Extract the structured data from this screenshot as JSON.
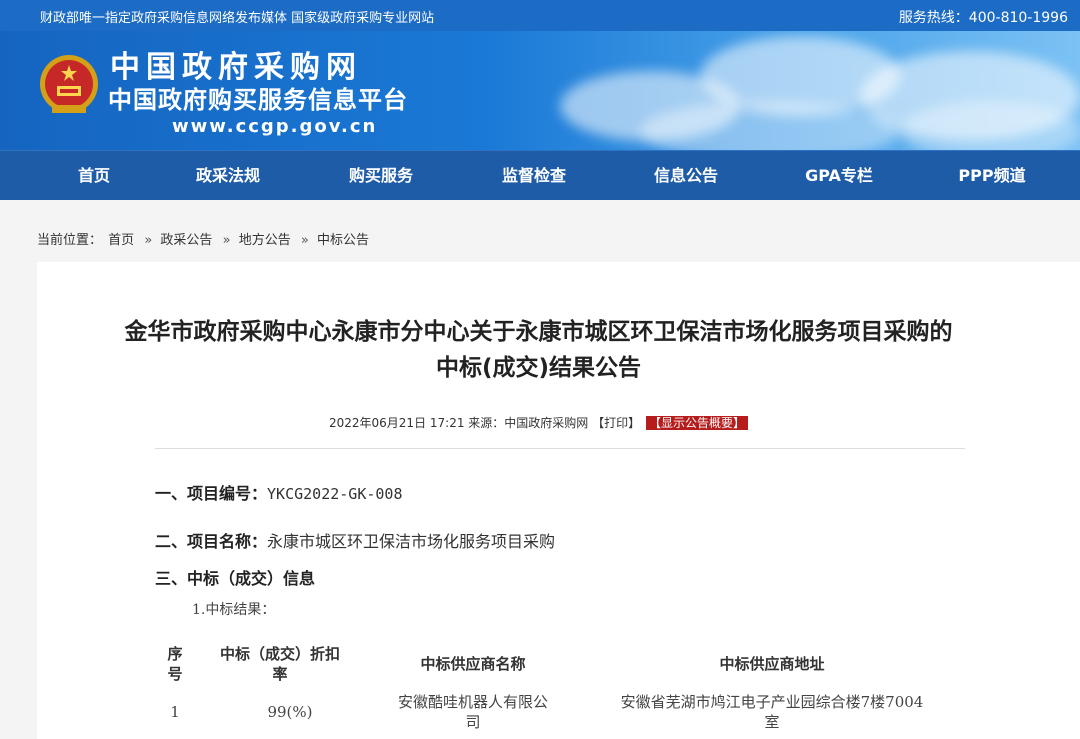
{
  "topbar": {
    "left_text": "财政部唯一指定政府采购信息网络发布媒体 国家级政府采购专业网站",
    "hotline": "服务热线：400-810-1996"
  },
  "logo": {
    "name": "中国政府采购网",
    "subtitle": "中国政府购买服务信息平台",
    "url": "www.ccgp.gov.cn"
  },
  "nav": {
    "items": [
      "首页",
      "政采法规",
      "购买服务",
      "监督检查",
      "信息公告",
      "GPA专栏",
      "PPP频道"
    ]
  },
  "breadcrumb": {
    "label": "当前位置：",
    "items": [
      "首页",
      "政采公告",
      "地方公告",
      "中标公告"
    ],
    "sep": "»"
  },
  "article": {
    "title_line1": "金华市政府采购中心永康市分中心关于永康市城区环卫保洁市场化服务项目采购的",
    "title_line2": "中标(成交)结果公告",
    "datetime": "2022年06月21日 17:21",
    "source": "来源：中国政府采购网",
    "print_label": "【打印】",
    "summary_label": "【显示公告概要】",
    "section1_label": "一、项目编号：",
    "section1_value": "YKCG2022-GK-008",
    "section2_label": "二、项目名称：",
    "section2_value": "永康市城区环卫保洁市场化服务项目采购",
    "section3_label": "三、中标（成交）信息",
    "sub1": "1.中标结果："
  },
  "table": {
    "headers": {
      "seq_line1": "序",
      "seq_line2": "号",
      "rate_line1": "中标（成交）折扣",
      "rate_line2": "率",
      "supplier": "中标供应商名称",
      "address": "中标供应商地址"
    },
    "rows": [
      {
        "seq": "1",
        "rate": "99(%)",
        "supplier_line1": "安徽酷哇机器人有限公",
        "supplier_line2": "司",
        "address_line1": "安徽省芜湖市鸠江电子产业园综合楼7楼7004",
        "address_line2": "室"
      }
    ]
  },
  "colors": {
    "topbar": "#1c6bc4",
    "nav": "#1f5ca8",
    "badge": "#b71c1c"
  }
}
